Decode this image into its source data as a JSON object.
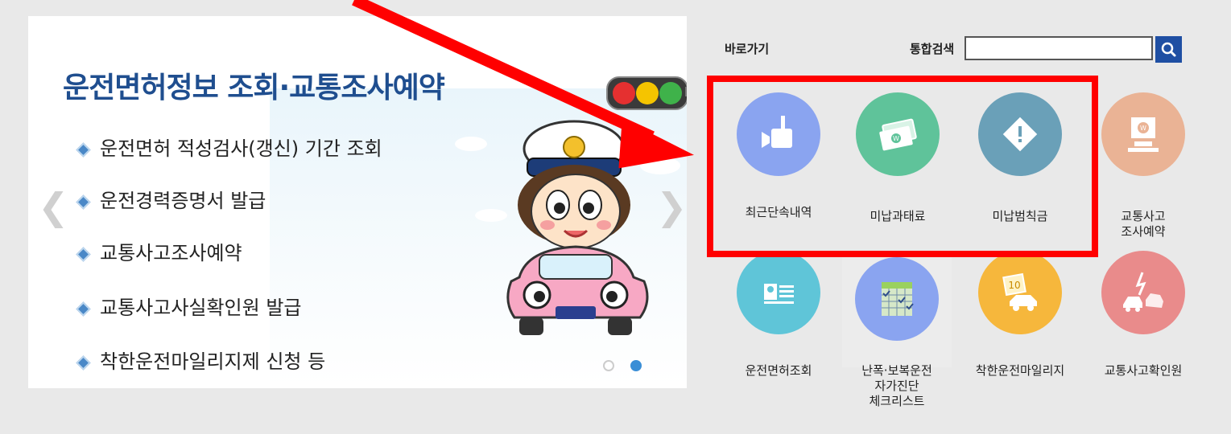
{
  "banner": {
    "title": "운전면허정보 조회·교통조사예약",
    "features": [
      "운전면허 적성검사(갱신) 기간 조회",
      "운전경력증명서 발급",
      "교통사고조사예약",
      "교통사고사실확인원 발급",
      "착한운전마일리지제 신청 등"
    ],
    "prev_icon": "chevron-left-icon",
    "next_icon": "chevron-right-icon",
    "slide_count": 2,
    "active_slide": 2
  },
  "quick_links_label": "바로가기",
  "search": {
    "label": "통합검색",
    "value": "",
    "button_icon": "search-icon"
  },
  "quick_menu": [
    {
      "label": "최근단속내역",
      "icon": "camera-icon",
      "color": "#8aa4f0"
    },
    {
      "label": "미납과태료",
      "icon": "money-icon",
      "color": "#5fc39a"
    },
    {
      "label": "미납범칙금",
      "icon": "warning-icon",
      "color": "#6aa0b8"
    },
    {
      "label": "교통사고\n조사예약",
      "icon": "computer-icon",
      "color": "#eab395"
    },
    {
      "label": "운전면허조회",
      "icon": "license-card-icon",
      "color": "#5fc5d8"
    },
    {
      "label": "난폭·보복운전\n자가진단\n체크리스트",
      "icon": "checklist-calendar-icon",
      "color": "#8aa4f0"
    },
    {
      "label": "착한운전마일리지",
      "icon": "mileage-car-icon",
      "color": "#f6b73c"
    },
    {
      "label": "교통사고확인원",
      "icon": "car-crash-icon",
      "color": "#e98b8b"
    }
  ],
  "colors": {
    "accent": "#1f4fa3",
    "title": "#1f4e8f",
    "highlight": "#ff0000"
  }
}
